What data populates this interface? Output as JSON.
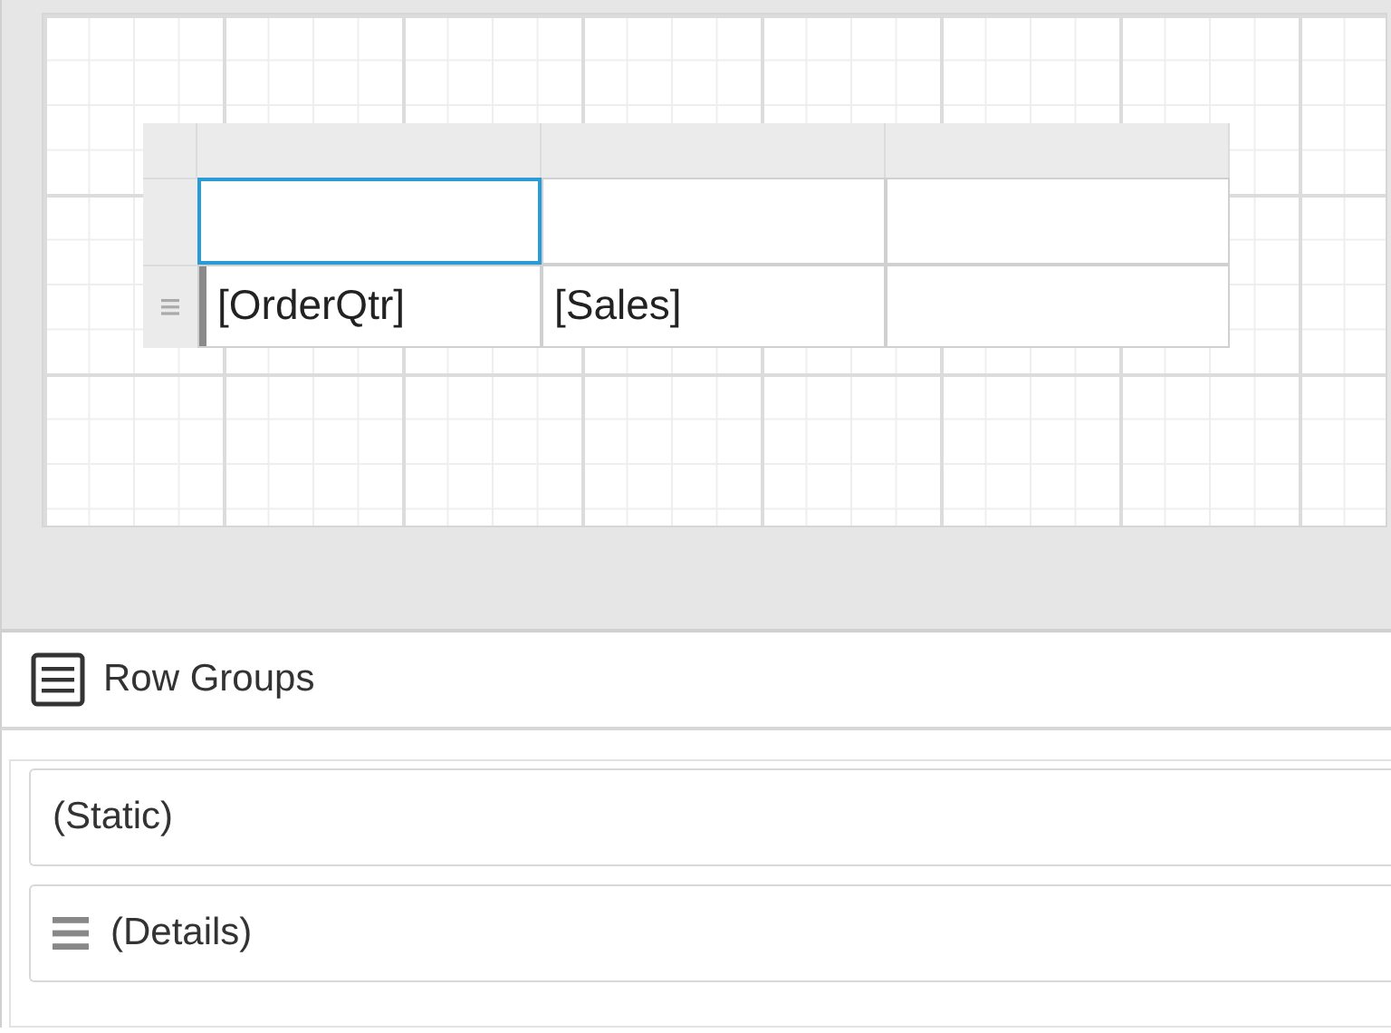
{
  "designer": {
    "table": {
      "rows": [
        {
          "details": false,
          "cells": [
            {
              "selected": true
            },
            {
              "selected": false
            },
            {
              "selected": false
            }
          ]
        },
        {
          "details": true,
          "cells": [
            {
              "text": "[OrderQtr]",
              "selected": false
            },
            {
              "text": "[Sales]",
              "selected": false
            },
            {
              "selected": false
            }
          ]
        }
      ]
    }
  },
  "row_groups": {
    "title": "Row Groups",
    "items": [
      {
        "label": "(Static)",
        "kind": "static"
      },
      {
        "label": "(Details)",
        "kind": "details"
      }
    ]
  }
}
